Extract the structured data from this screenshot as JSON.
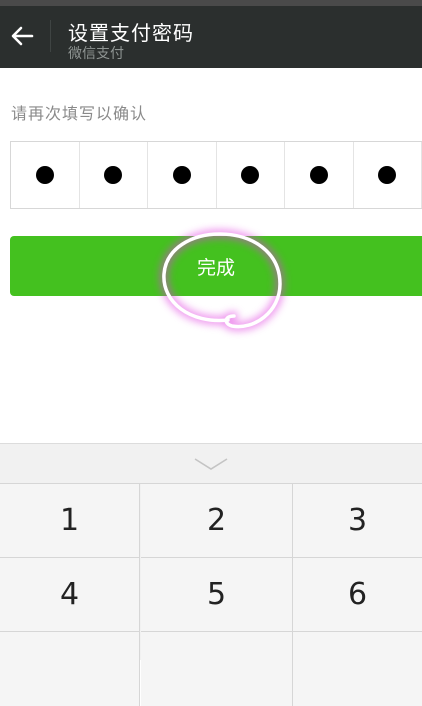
{
  "header": {
    "title": "设置支付密码",
    "subtitle": "微信支付",
    "back_icon": "arrow-left-icon"
  },
  "prompt": "请再次填写以确认",
  "pin": {
    "length": 6,
    "filled": 6
  },
  "done_button": {
    "label": "完成",
    "color": "#44c11f"
  },
  "annotation": {
    "color": "#ffffff",
    "glow": "#e040e0"
  },
  "keyboard": {
    "collapse_icon": "chevron-down-icon",
    "keys": [
      "1",
      "2",
      "3",
      "4",
      "5",
      "6"
    ]
  }
}
